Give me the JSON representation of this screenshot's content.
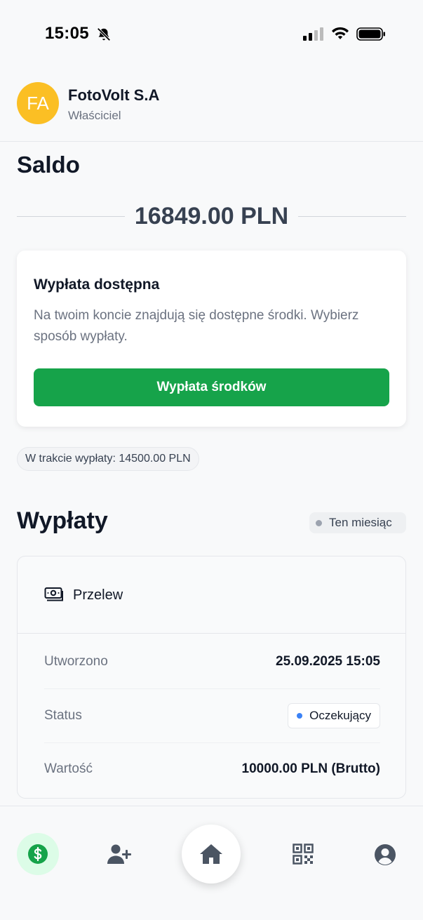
{
  "status_bar": {
    "time": "15:05"
  },
  "header": {
    "avatar_initials": "FA",
    "company_name": "FotoVolt S.A",
    "role": "Właściciel"
  },
  "balance": {
    "title": "Saldo",
    "amount": "16849.00 PLN"
  },
  "payout_card": {
    "title": "Wypłata dostępna",
    "description": "Na twoim koncie znajdują się dostępne środki. Wybierz sposób wypłaty.",
    "button_label": "Wypłata środków"
  },
  "pending": {
    "text": "W trakcie wypłaty: 14500.00 PLN"
  },
  "payouts": {
    "title": "Wypłaty",
    "period_filter": "Ten miesiąc",
    "items": [
      {
        "method": "Przelew",
        "created_label": "Utworzono",
        "created_value": "25.09.2025 15:05",
        "status_label": "Status",
        "status_value": "Oczekujący",
        "amount_label": "Wartość",
        "amount_value": "10000.00 PLN (Brutto)"
      }
    ]
  },
  "bottom_nav": {
    "items": [
      {
        "icon": "dollar-icon",
        "active": true
      },
      {
        "icon": "user-plus-icon",
        "active": false
      },
      {
        "icon": "home-icon",
        "active": false
      },
      {
        "icon": "qr-code-icon",
        "active": false
      },
      {
        "icon": "user-circle-icon",
        "active": false
      }
    ]
  },
  "colors": {
    "accent_green": "#16a34a",
    "avatar_bg": "#fbbf24",
    "status_dot_blue": "#3b82f6"
  }
}
